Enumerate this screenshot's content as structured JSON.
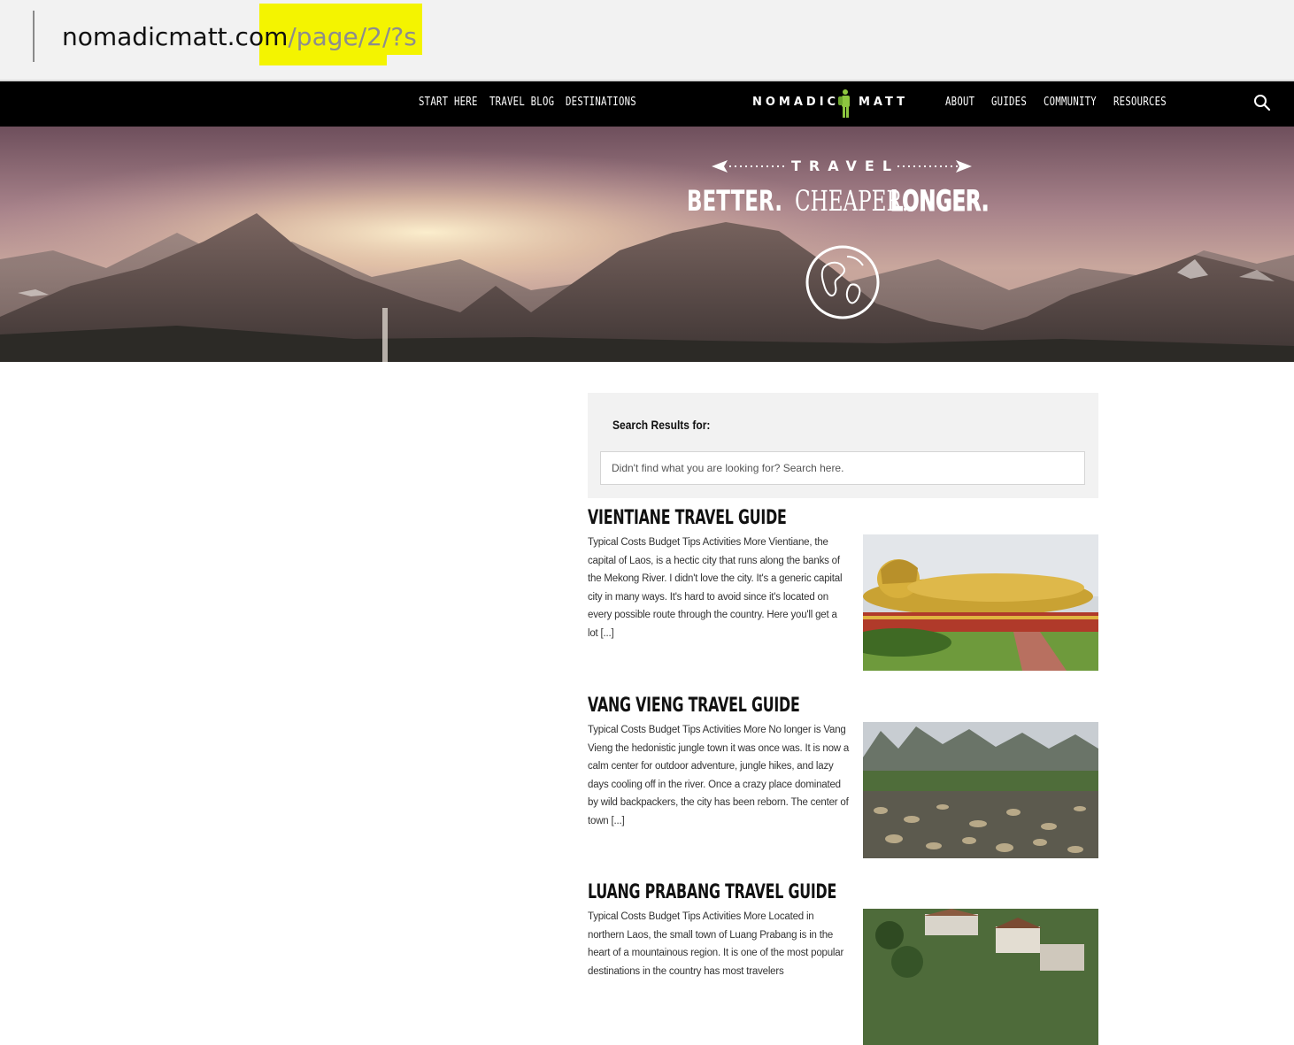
{
  "browser": {
    "url_host": "nomadicmatt.com",
    "url_path": "/page/2/?s"
  },
  "nav": {
    "left_items": [
      "START HERE",
      "TRAVEL BLOG",
      "DESTINATIONS"
    ],
    "right_items": [
      "ABOUT",
      "GUIDES",
      "COMMUNITY",
      "RESOURCES"
    ],
    "logo_left": "NOMADIC",
    "logo_right": "MATT",
    "search_icon": "search-icon"
  },
  "hero": {
    "kicker": "TRAVEL",
    "tagline": [
      "BETTER.",
      "CHEAPER.",
      "LONGER."
    ],
    "globe_icon": "globe-icon"
  },
  "search": {
    "title": "Search Results for:",
    "placeholder": "Didn't find what you are looking for? Search here."
  },
  "results": [
    {
      "title": "VIENTIANE TRAVEL GUIDE",
      "excerpt": "Typical Costs Budget Tips Activities More Vientiane, the capital of Laos, is a hectic city that runs along the banks of the Mekong River. I didn't love the city. It's a generic capital city in many ways. It's hard to avoid since it's located on every possible route through the country. Here you'll get a lot [...]",
      "image": "reclining golden buddha statue"
    },
    {
      "title": "VANG VIENG TRAVEL GUIDE",
      "excerpt": "Typical Costs Budget Tips Activities More No longer is Vang Vieng the hedonistic jungle town it was once was. It is now a calm center for outdoor adventure, jungle hikes, and lazy days cooling off in the river. Once a crazy place dominated by wild backpackers, the city has been reborn. The center of town [...]",
      "image": "rocky river with karst mountains"
    },
    {
      "title": "LUANG PRABANG TRAVEL GUIDE",
      "excerpt": "Typical Costs Budget Tips Activities More Located in northern Laos, the small town of Luang Prabang is in the heart of a mountainous region. It is one of the most popular destinations in the country has most travelers",
      "image": "town rooftops among palm trees"
    }
  ],
  "colors": {
    "nav_bg": "#000000",
    "highlight": "#f4f400",
    "search_box_bg": "#f2f2f2",
    "logo_figure": "#8dc63f"
  }
}
